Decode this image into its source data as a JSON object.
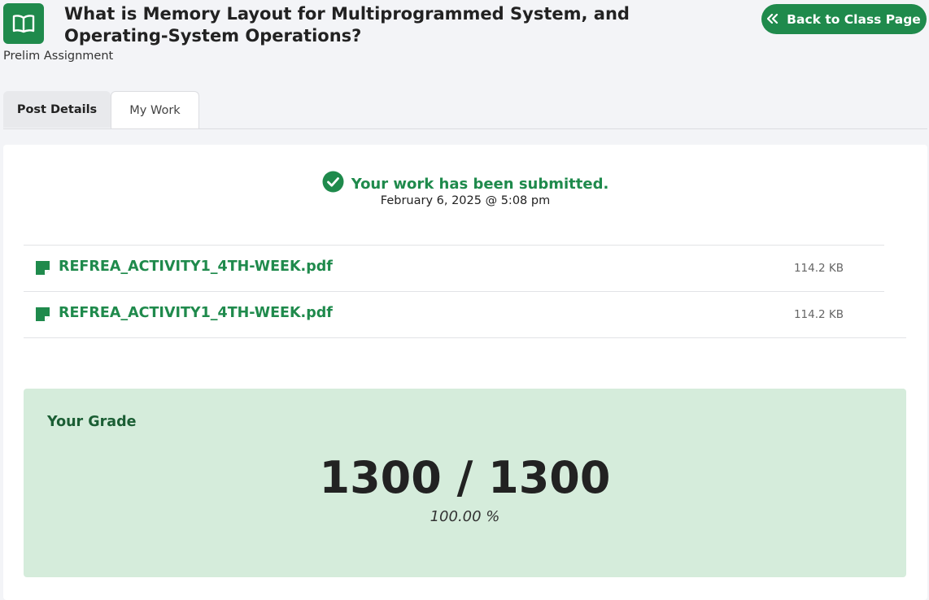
{
  "header": {
    "icon": "open-book-icon",
    "title": "What is Memory Layout for Multiprogrammed System, and Operating-System Operations?",
    "subtitle": "Prelim Assignment",
    "back_button": {
      "icon": "double-chevron-left-icon",
      "label": "Back to Class Page"
    }
  },
  "tabs": [
    {
      "label": "Post Details",
      "active": false
    },
    {
      "label": "My Work",
      "active": true
    }
  ],
  "submission": {
    "status_icon": "check-circle-icon",
    "status_text": "Your work has been submitted.",
    "date": "February 6, 2025 @ 5:08 pm"
  },
  "files": [
    {
      "icon": "file-icon",
      "name": "REFREA_ACTIVITY1_4TH-WEEK.pdf",
      "size": "114.2 KB"
    },
    {
      "icon": "file-icon",
      "name": "REFREA_ACTIVITY1_4TH-WEEK.pdf",
      "size": "114.2 KB"
    }
  ],
  "grade": {
    "label": "Your Grade",
    "score": "1300 / 1300",
    "percent": "100.00 %"
  },
  "colors": {
    "accent": "#1f8a4c",
    "grade_bg": "#d5ecdb",
    "page_bg": "#f3f4f7"
  }
}
